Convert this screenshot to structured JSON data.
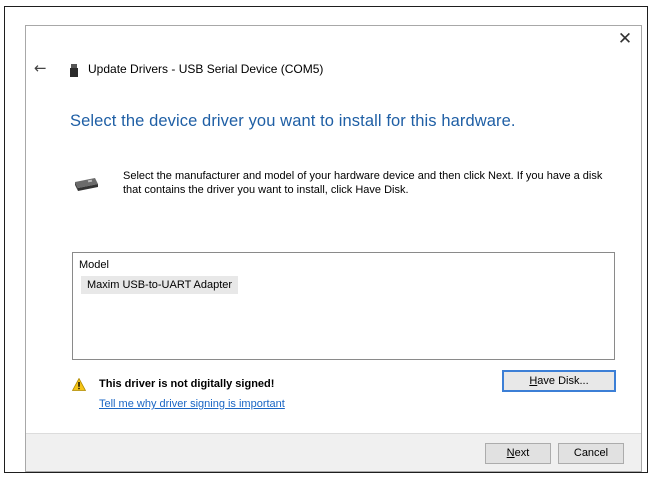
{
  "window": {
    "title": "Update Drivers - USB Serial Device (COM5)",
    "close_glyph": "✕",
    "back_glyph": "←"
  },
  "heading": "Select the device driver you want to install for this hardware.",
  "instructions": "Select the manufacturer and model of your hardware device and then click Next. If you have a disk that contains the driver you want to install, click Have Disk.",
  "model_list": {
    "header": "Model",
    "items": [
      "Maxim USB-to-UART Adapter"
    ]
  },
  "warning": {
    "text": "This driver is not digitally signed!",
    "link": "Tell me why driver signing is important"
  },
  "buttons": {
    "have_disk": "Have Disk...",
    "next": "Next",
    "cancel": "Cancel"
  },
  "colors": {
    "heading": "#1f5fa5",
    "link": "#1a66c4",
    "warning_fill": "#f5c518",
    "focus_border": "#3c7fd6"
  }
}
